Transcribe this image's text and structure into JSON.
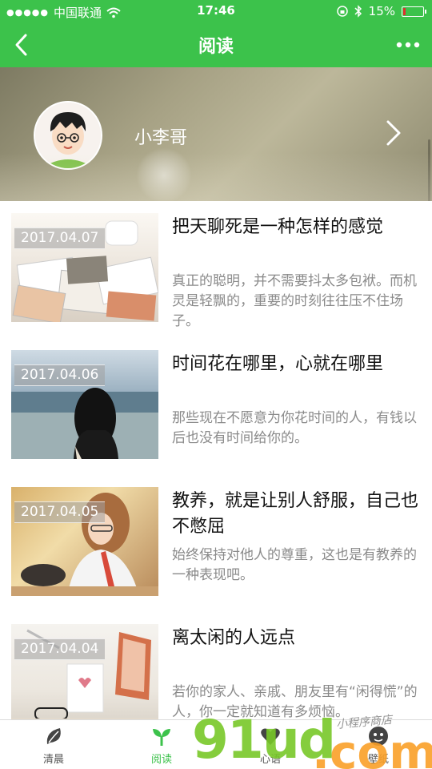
{
  "status_bar": {
    "carrier": "中国联通",
    "time": "17:46",
    "battery": "15%",
    "battery_level": 0.15
  },
  "nav": {
    "title": "阅读",
    "back_icon": "chevron-left-icon",
    "more_icon": "more-dots-icon"
  },
  "profile": {
    "name": "小李哥",
    "arrow_icon": "chevron-right-icon"
  },
  "articles": [
    {
      "date": "2017.04.07",
      "title": "把天聊死是一种怎样的感觉",
      "summary": "真正的聪明，并不需要抖太多包袱。而机灵是轻飘的，重要的时刻往往压不住场子。"
    },
    {
      "date": "2017.04.06",
      "title": "时间花在哪里，心就在哪里",
      "summary": "那些现在不愿意为你花时间的人，有钱以后也没有时间给你的。"
    },
    {
      "date": "2017.04.05",
      "title": "教养，就是让别人舒服，自己也不憋屈",
      "summary": "始终保持对他人的尊重，这也是有教养的一种表现吧。"
    },
    {
      "date": "2017.04.04",
      "title": "离太闲的人远点",
      "summary": "若你的家人、亲戚、朋友里有“闲得慌”的人，你一定就知道有多烦恼。"
    }
  ],
  "tabs": [
    {
      "label": "清晨",
      "icon": "leaf-icon"
    },
    {
      "label": "阅读",
      "icon": "sprout-icon"
    },
    {
      "label": "心语",
      "icon": "heart-icon"
    },
    {
      "label": "壁纸",
      "icon": "face-icon"
    }
  ],
  "watermark": {
    "main": "91ud",
    "suffix": ".com",
    "small": "小程序商店"
  },
  "colors": {
    "brand": "#3cc24b",
    "summary_text": "#8a8a8a"
  }
}
